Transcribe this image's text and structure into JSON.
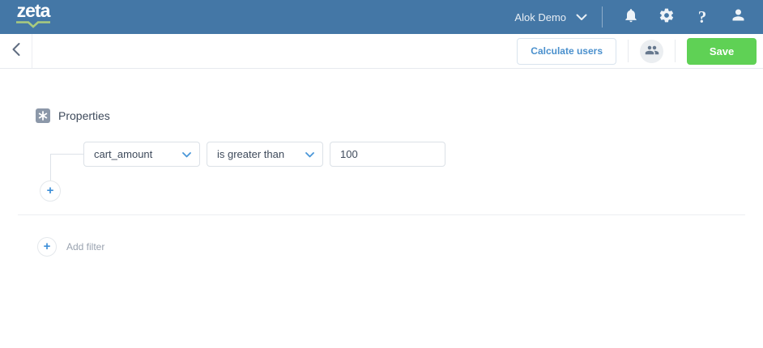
{
  "navbar": {
    "logo_text": "zeta",
    "account_name": "Alok Demo"
  },
  "toolbar": {
    "calculate_users_label": "Calculate users",
    "save_label": "Save"
  },
  "properties": {
    "section_title": "Properties",
    "filter": {
      "property": "cart_amount",
      "operator": "is greater than",
      "value": "100"
    },
    "add_filter_label": "Add filter",
    "plus_glyph": "+"
  },
  "icons": {
    "navbar": [
      "chevron-down-icon",
      "bell-icon",
      "gear-icon",
      "question-icon",
      "user-icon"
    ],
    "toolbar": [
      "back-chevron-icon",
      "users-group-icon"
    ],
    "content": [
      "asterisk-icon",
      "plus-icon"
    ]
  },
  "colors": {
    "navbar_bg": "#4477a6",
    "logo_underline_green": "#a9cb7e",
    "save_green": "#5fd155",
    "link_blue": "#4a90cd",
    "accent_blue": "#3e8fd8",
    "box_border": "#dce1e7",
    "text_dark": "#3e4a5b",
    "text_muted": "#9aa3b0"
  }
}
